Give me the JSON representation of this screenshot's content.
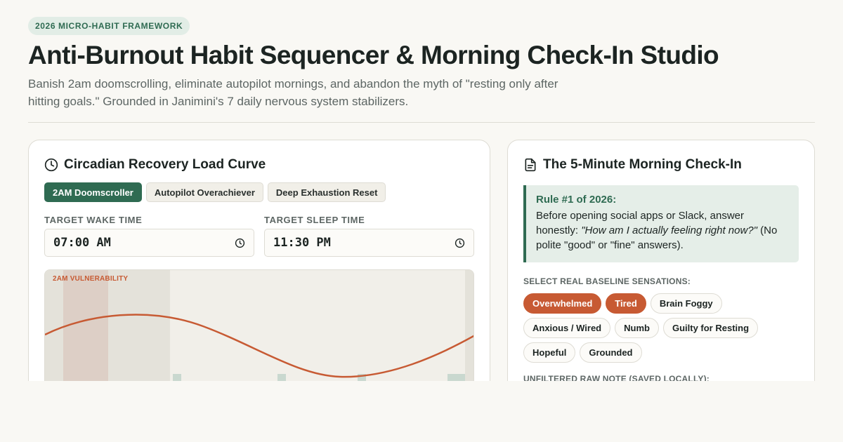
{
  "header": {
    "badge": "2026 MICRO-HABIT FRAMEWORK",
    "title": "Anti-Burnout Habit Sequencer & Morning Check-In Studio",
    "subtitle": "Banish 2am doomscrolling, eliminate autopilot mornings, and abandon the myth of \"resting only after hitting goals.\" Grounded in Janimini's 7 daily nervous system stabilizers."
  },
  "curve_card": {
    "icon": "clock-icon",
    "title": "Circadian Recovery Load Curve",
    "presets": [
      {
        "label": "2AM Doomscroller",
        "active": true
      },
      {
        "label": "Autopilot Overachiever",
        "active": false
      },
      {
        "label": "Deep Exhaustion Reset",
        "active": false
      }
    ],
    "wake": {
      "label": "TARGET WAKE TIME",
      "value": "07:00 AM"
    },
    "sleep": {
      "label": "TARGET SLEEP TIME",
      "value": "11:30 PM"
    },
    "chart_label": "2AM VULNERABILITY"
  },
  "checkin_card": {
    "icon": "document-icon",
    "title": "The 5-Minute Morning Check-In",
    "rule_title": "Rule #1 of 2026:",
    "rule_lead": "Before opening social apps or Slack, answer honestly: ",
    "rule_question": "\"How am I actually feeling right now?\"",
    "rule_tail": " (No polite \"good\" or \"fine\" answers).",
    "sensations_label": "SELECT REAL BASELINE SENSATIONS:",
    "sensations": [
      {
        "label": "Overwhelmed",
        "selected": true
      },
      {
        "label": "Tired",
        "selected": true
      },
      {
        "label": "Brain Foggy",
        "selected": false
      },
      {
        "label": "Anxious / Wired",
        "selected": false
      },
      {
        "label": "Numb",
        "selected": false
      },
      {
        "label": "Guilty for Resting",
        "selected": false
      },
      {
        "label": "Hopeful",
        "selected": false
      },
      {
        "label": "Grounded",
        "selected": false
      }
    ],
    "note_label": "UNFILTERED RAW NOTE (SAVED LOCALLY):"
  },
  "colors": {
    "accent_green": "#2f6b52",
    "accent_orange": "#c75a33",
    "background": "#f9f8f4"
  }
}
